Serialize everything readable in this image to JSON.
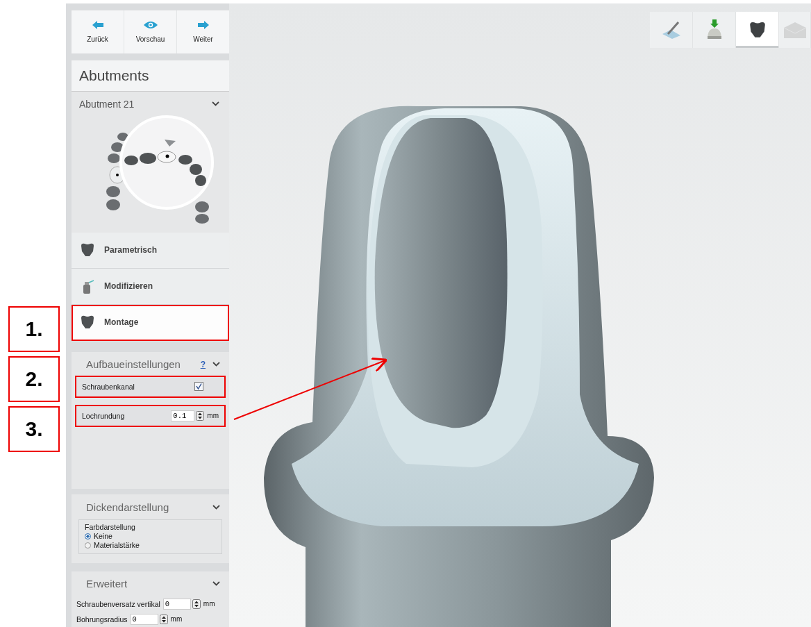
{
  "nav_buttons": [
    {
      "kind": "back",
      "label": "Zurück"
    },
    {
      "kind": "preview",
      "label": "Vorschau"
    },
    {
      "kind": "next",
      "label": "Weiter"
    }
  ],
  "panel_title": "Abutments",
  "abutment_selector": {
    "label": "Abutment 21"
  },
  "steps": [
    {
      "label": "Parametrisch",
      "selected": false,
      "highlighted": false
    },
    {
      "label": "Modifizieren",
      "selected": false,
      "highlighted": false
    },
    {
      "label": "Montage",
      "selected": true,
      "highlighted": true
    }
  ],
  "settings": {
    "title": "Aufbaueinstellungen",
    "help": "?",
    "fields": [
      {
        "kind": "checkbox",
        "label": "Schraubenkanal",
        "checked": true,
        "highlighted": true
      },
      {
        "kind": "spin",
        "label": "Lochrundung",
        "value": "0.1",
        "unit": "mm",
        "highlighted": true
      }
    ]
  },
  "thickness": {
    "title": "Dickendarstellung",
    "group": "Farbdarstellung",
    "options": [
      {
        "label": "Keine",
        "selected": true
      },
      {
        "label": "Materialstärke",
        "selected": false
      }
    ]
  },
  "advanced": {
    "title": "Erweitert",
    "fields": [
      {
        "label": "Schraubenversatz vertikal",
        "value": "0",
        "unit": "mm"
      },
      {
        "label": "Bohrungsradius",
        "value": "0",
        "unit": "mm"
      }
    ]
  },
  "workflow": [
    {
      "kind": "design",
      "selected": false,
      "disabled": false
    },
    {
      "kind": "insert",
      "selected": false,
      "disabled": false
    },
    {
      "kind": "abutment",
      "selected": true,
      "disabled": false
    },
    {
      "kind": "export",
      "selected": false,
      "disabled": true
    }
  ],
  "annotations": [
    {
      "label": "1."
    },
    {
      "label": "2."
    },
    {
      "label": "3."
    }
  ]
}
